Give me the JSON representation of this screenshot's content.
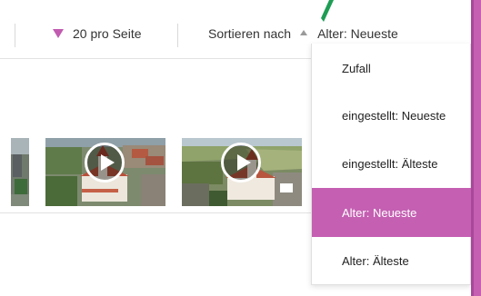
{
  "toolbar": {
    "per_page_label": "20 pro Seite",
    "sort_label": "Sortieren nach",
    "sort_value": "Alter: Neueste"
  },
  "sort_dropdown": {
    "selected": "Alter: Neueste",
    "options": [
      "Zufall",
      "eingestellt: Neueste",
      "eingestellt: Älteste",
      "Alter: Neueste",
      "Alter: Älteste"
    ]
  },
  "colors": {
    "accent": "#c45fb2",
    "marker_green": "#1f9d55",
    "divider": "#e2e2e2"
  },
  "icons": {
    "per_page": "triangle-down-icon",
    "sort_direction": "sort-up-arrow-icon",
    "video": "play-icon"
  }
}
